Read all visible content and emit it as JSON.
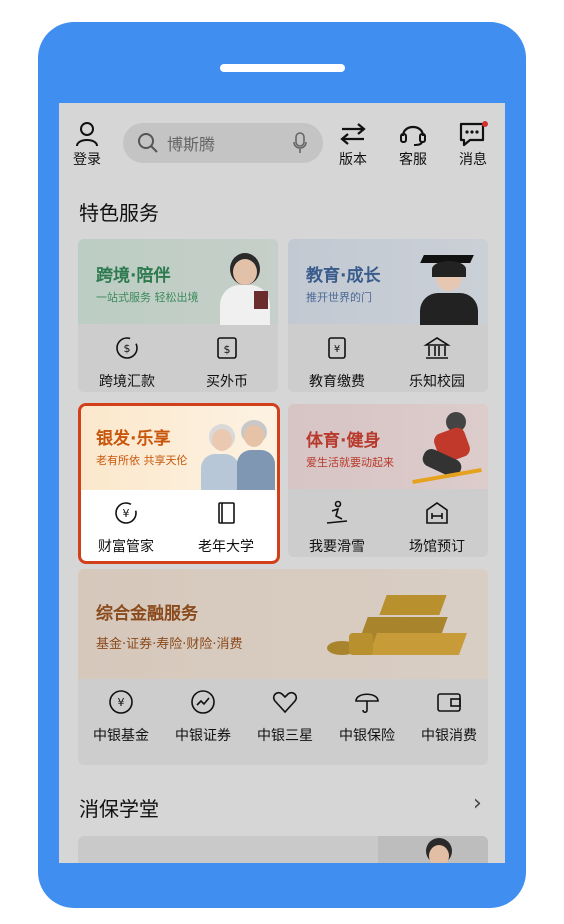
{
  "header": {
    "login_label": "登录",
    "search_placeholder": "博斯腾",
    "version_label": "版本",
    "service_label": "客服",
    "messages_label": "消息"
  },
  "featured": {
    "title": "特色服务",
    "cards": [
      {
        "title": "跨境·陪伴",
        "subtitle": "一站式服务 轻松出境",
        "items": [
          "跨境汇款",
          "买外币"
        ]
      },
      {
        "title": "教育·成长",
        "subtitle": "推开世界的门",
        "items": [
          "教育缴费",
          "乐知校园"
        ]
      },
      {
        "title": "银发·乐享",
        "subtitle": "老有所依 共享天伦",
        "items": [
          "财富管家",
          "老年大学"
        ]
      },
      {
        "title": "体育·健身",
        "subtitle": "爱生活就要动起来",
        "items": [
          "我要滑雪",
          "场馆预订"
        ]
      }
    ]
  },
  "finance": {
    "title": "综合金融服务",
    "subtitle": "基金·证券·寿险·财险·消费",
    "items": [
      "中银基金",
      "中银证券",
      "中银三星",
      "中银保险",
      "中银消费"
    ]
  },
  "school": {
    "title": "消保学堂"
  },
  "colors": {
    "phone": "#3f8ef0",
    "highlight_border": "#d2401b",
    "title_green": "#2e8b57",
    "title_blue": "#3a5c8c",
    "title_orange": "#c8560c",
    "title_red": "#c0392b",
    "finance_title": "#8a4a1c"
  }
}
